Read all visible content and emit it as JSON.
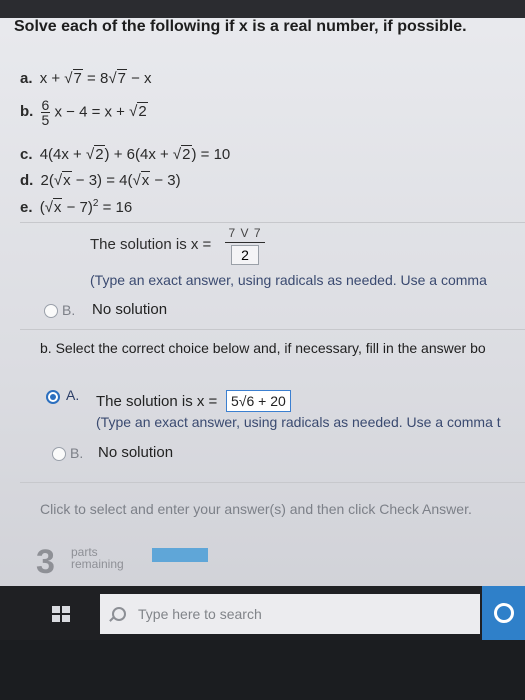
{
  "title": "Solve each of the following if x is a real number, if possible.",
  "problems": {
    "a": {
      "label": "a.",
      "pre": "x +",
      "rad": "7",
      "eq": " = 8",
      "rad2": "7",
      "post": " − x"
    },
    "b": {
      "label": "b.",
      "num": "6",
      "den": "5",
      "mid": "x − 4 = x +",
      "rad": "2"
    },
    "c": {
      "label": "c.",
      "p1": "4(4x +",
      "rad1": "2",
      "p2": ") + 6(4x +",
      "rad2": "2",
      "p3": ") = 10"
    },
    "d": {
      "label": "d.",
      "p1": "2(",
      "rad1": "x",
      "p2": " − 3) = 4(",
      "rad2": "x",
      "p3": " − 3)"
    },
    "e": {
      "label": "e.",
      "p1": "(",
      "rad": "x",
      "p2": " − 7)",
      "exp": "2",
      "p3": " = 16"
    }
  },
  "part_a": {
    "solution_text": "The solution is x =",
    "numerator_partial": "7 V 7",
    "denominator": "2",
    "hint": "(Type an exact answer, using radicals as needed. Use a comma",
    "option_b_letter": "B.",
    "option_b_text": "No solution"
  },
  "part_b": {
    "prompt": "b. Select the correct choice below and, if necessary, fill in the answer bo",
    "option_a_letter": "A.",
    "option_a_text": "The solution is x =",
    "answer": "5√6 + 20",
    "hint": "(Type an exact answer, using radicals as needed. Use a comma t",
    "option_b_letter": "B.",
    "option_b_text": "No solution"
  },
  "footer": {
    "click_hint": "Click to select and enter your answer(s) and then click Check Answer.",
    "parts_count": "3",
    "parts_label_1": "parts",
    "parts_label_2": "remaining",
    "progress_fraction": 1.0
  },
  "taskbar": {
    "search_placeholder": "Type here to search"
  },
  "colors": {
    "accent": "#2c6fbf",
    "progress": "#5fa6d8",
    "cortana": "#2f80c9"
  }
}
